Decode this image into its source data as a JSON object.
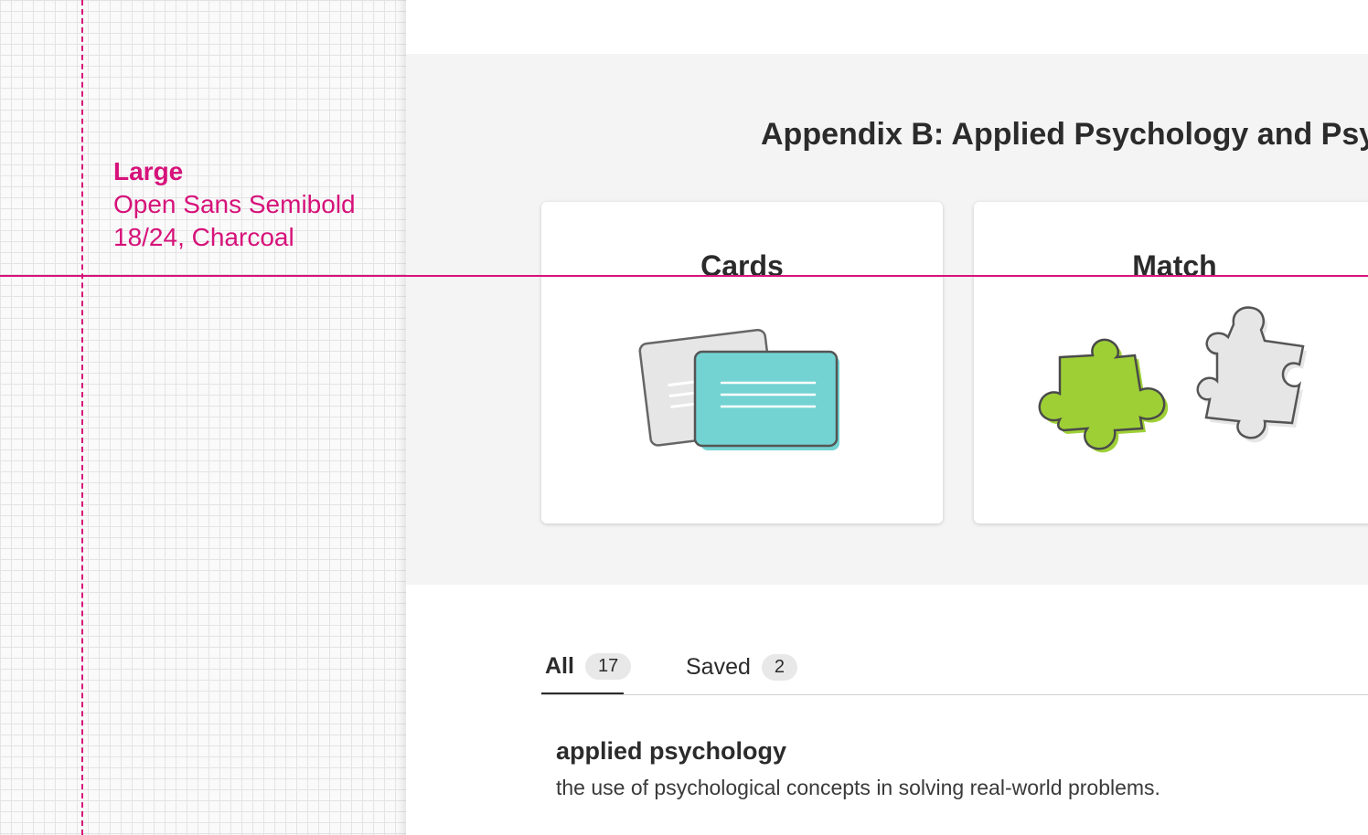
{
  "spec": {
    "title": "Large",
    "line2": "Open Sans Semibold",
    "line3": "18/24, Charcoal",
    "guide_color": "#d6127a"
  },
  "page": {
    "title": "Appendix B: Applied Psychology and Psyc"
  },
  "modes": {
    "cards_label": "Cards",
    "match_label": "Match",
    "cards_icon": "flashcards-icon",
    "match_icon": "puzzle-pieces-icon",
    "teal": "#73d3d2",
    "green": "#9ed036"
  },
  "tabs": {
    "all_label": "All",
    "all_count": "17",
    "saved_label": "Saved",
    "saved_count": "2"
  },
  "terms": [
    {
      "word": "applied psychology",
      "definition": "the use of psychological concepts in solving real-world problems."
    }
  ]
}
